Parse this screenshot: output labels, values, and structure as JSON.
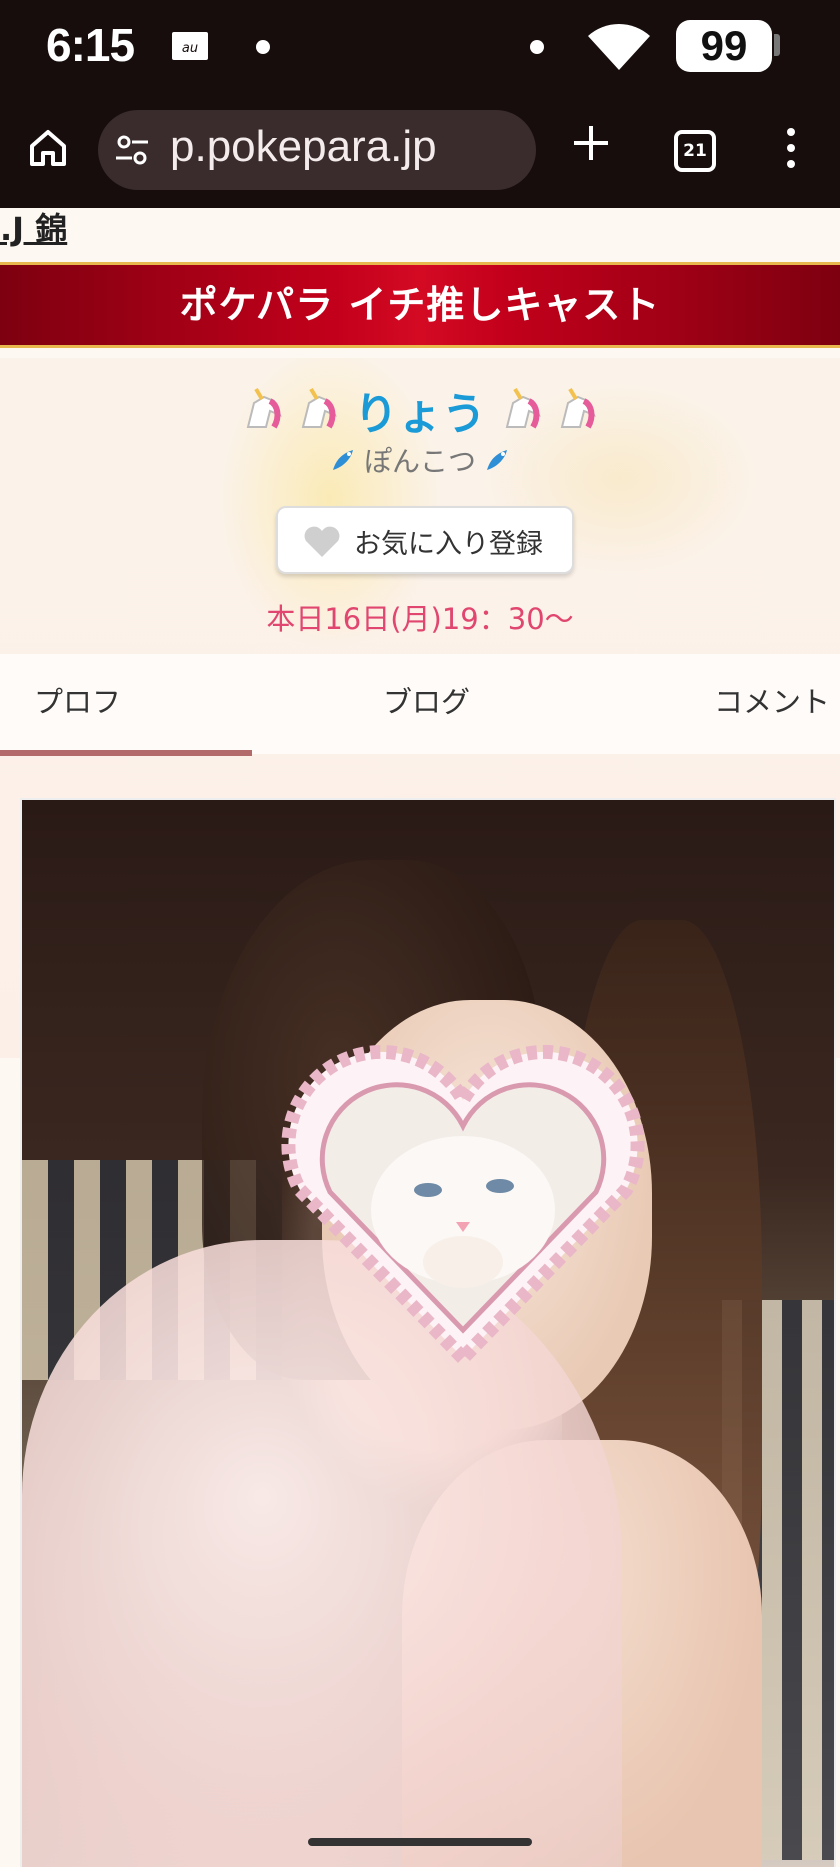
{
  "status_bar": {
    "time": "6:15",
    "battery": "99",
    "icons": [
      "au-carrier-icon",
      "notification-dot",
      "notification-dot",
      "wifi-icon",
      "battery-icon"
    ]
  },
  "browser": {
    "url": "p.pokepara.jp",
    "tab_count": "21",
    "icons": [
      "home-icon",
      "site-settings-icon",
      "new-tab-icon",
      "tabs-icon",
      "more-menu-icon"
    ]
  },
  "page": {
    "top_link": ".J 錦",
    "banner_title": "ポケパラ イチ推しキャスト",
    "cast": {
      "name": "りょう",
      "subtitle": "ぽんこつ",
      "name_emoji": "unicorn-icon",
      "subtitle_emoji": "dragon-icon"
    },
    "favorite_button": "お気に入り登録",
    "schedule": "本日16日(月)19：30〜",
    "tabs": [
      {
        "label": "プロフ",
        "active": true
      },
      {
        "label": "ブログ",
        "active": false
      },
      {
        "label": "コメント",
        "active": false
      }
    ],
    "accent_colors": {
      "banner": "#c3001b",
      "name": "#1a9ad6",
      "schedule": "#e0466f",
      "tab_underline": "#b36a6a"
    }
  }
}
